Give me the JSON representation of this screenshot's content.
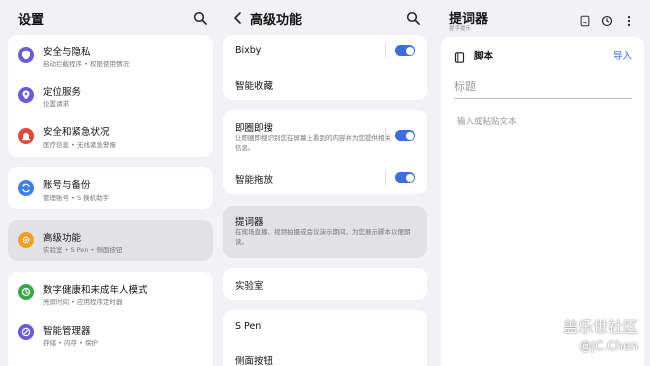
{
  "settings": {
    "title": "设置",
    "items": [
      {
        "title": "安全与隐私",
        "subtitle": "启动拦截程序 • 权限使用情况",
        "icon": "shield-icon",
        "color": "#6a5ad6"
      },
      {
        "title": "定位服务",
        "subtitle": "位置请求",
        "icon": "location-pin-icon",
        "color": "#6a5ad6"
      },
      {
        "title": "安全和紧急状况",
        "subtitle": "医疗信息 • 无线紧急警报",
        "icon": "emergency-icon",
        "color": "#e04a3c"
      },
      {
        "title": "账号与备份",
        "subtitle": "管理账号 • S 换机助手",
        "icon": "sync-icon",
        "color": "#3d7ee8"
      },
      {
        "title": "高级功能",
        "subtitle": "实验室 • S Pen • 侧面按钮",
        "icon": "gear-plus-icon",
        "color": "#f0a020"
      },
      {
        "title": "数字健康和未成年人模式",
        "subtitle": "亮屏时间 • 应用程序定时器",
        "icon": "wellbeing-icon",
        "color": "#3aa84a"
      },
      {
        "title": "智能管理器",
        "subtitle": "存储 • 内存 • 保护",
        "icon": "device-care-icon",
        "color": "#6a5ad6"
      }
    ]
  },
  "advanced": {
    "title": "高级功能",
    "bixby": "Bixby",
    "smart_collect": "智能收藏",
    "circle_search": "即圈即搜",
    "circle_search_desc": "让即圈即搜识别您在屏幕上看到的内容并为您提供相关信息。",
    "smart_drag": "智能拖放",
    "teleprompter": "提词器",
    "teleprompter_desc": "在现场直播、视频拍摄或会议演示期间，为您展示脚本以便朗读。",
    "labs": "实验室",
    "spen": "S Pen",
    "side_button": "侧面按钮"
  },
  "teleprompter": {
    "title": "提词器",
    "subtitle": "提字提示",
    "script_label": "脚本",
    "import_label": "导入",
    "title_placeholder": "标题",
    "text_placeholder": "输入或粘贴文本"
  },
  "watermark": {
    "line1": "盖乐世社区",
    "line2": "@JC.Chen"
  },
  "colors": {
    "accent": "#3e6fd9",
    "background": "#f2f2f6",
    "highlight": "#e1e1e6"
  }
}
